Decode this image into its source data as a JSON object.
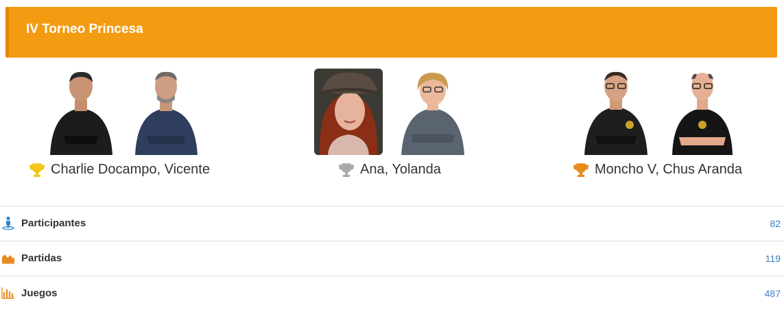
{
  "header": {
    "title": "IV Torneo Princesa",
    "color": "#f39c12"
  },
  "podium": [
    {
      "place": 1,
      "trophy_icon": "gold-trophy-icon",
      "trophy_color": "#f5c518",
      "names": "Charlie Docampo, Vicente"
    },
    {
      "place": 2,
      "trophy_icon": "silver-trophy-icon",
      "trophy_color": "#a9a9a9",
      "names": "Ana, Yolanda"
    },
    {
      "place": 3,
      "trophy_icon": "bronze-trophy-icon",
      "trophy_color": "#e8891c",
      "names": "Moncho V, Chus Aranda"
    }
  ],
  "stats": [
    {
      "icon": "participants-icon",
      "label": "Participantes",
      "value": "82"
    },
    {
      "icon": "area-chart-icon",
      "label": "Partidas",
      "value": "119"
    },
    {
      "icon": "bar-chart-icon",
      "label": "Juegos",
      "value": "487"
    }
  ]
}
